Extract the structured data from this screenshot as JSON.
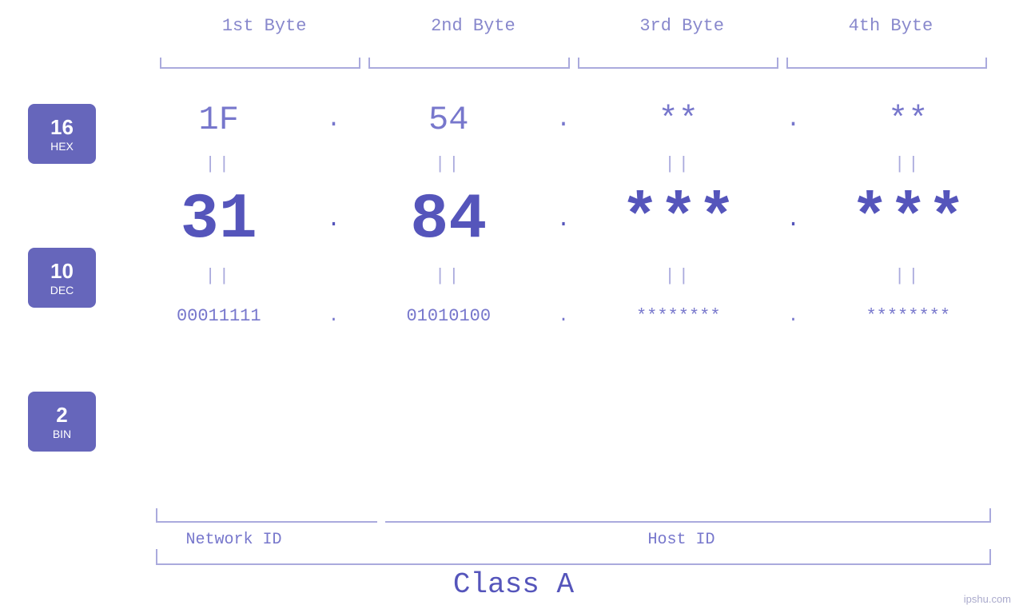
{
  "header": {
    "byte1": "1st Byte",
    "byte2": "2nd Byte",
    "byte3": "3rd Byte",
    "byte4": "4th Byte"
  },
  "bases": [
    {
      "number": "16",
      "label": "HEX"
    },
    {
      "number": "10",
      "label": "DEC"
    },
    {
      "number": "2",
      "label": "BIN"
    }
  ],
  "hex_row": {
    "b1": "1F",
    "b2": "54",
    "b3": "**",
    "b4": "**",
    "dot": "."
  },
  "dec_row": {
    "b1": "31",
    "b2": "84",
    "b3": "***",
    "b4": "***",
    "dot": "."
  },
  "bin_row": {
    "b1": "00011111",
    "b2": "01010100",
    "b3": "********",
    "b4": "********",
    "dot": "."
  },
  "equals": "||",
  "labels": {
    "network_id": "Network ID",
    "host_id": "Host ID",
    "class": "Class A"
  },
  "watermark": "ipshu.com"
}
